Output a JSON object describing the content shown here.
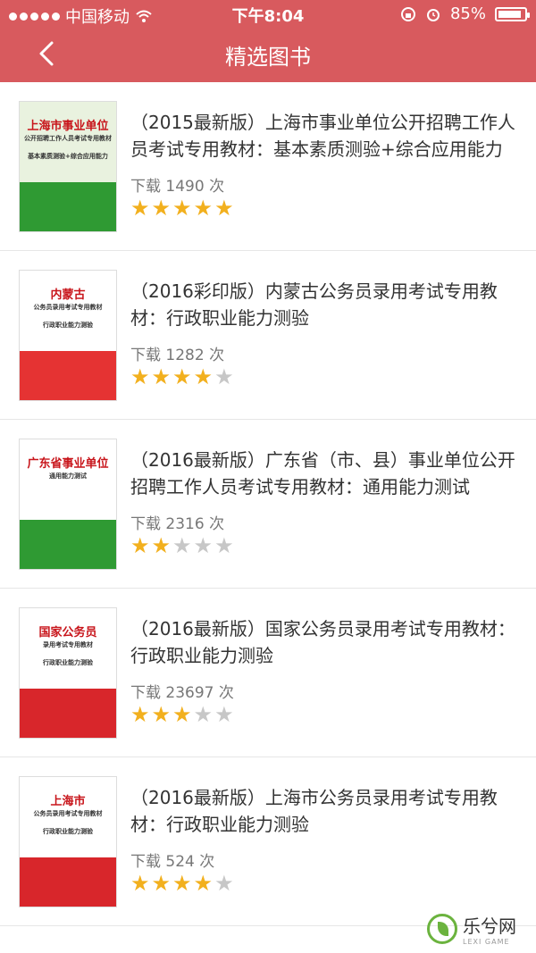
{
  "status": {
    "carrier": "中国移动",
    "time": "下午8:04",
    "battery": "85%"
  },
  "nav": {
    "title": "精选图书"
  },
  "books": [
    {
      "title": "（2015最新版）上海市事业单位公开招聘工作人员考试专用教材：基本素质测验+综合应用能力",
      "downloads": "下载 1490 次",
      "rating": 5,
      "cover": {
        "bg": "#2f9a33",
        "accent": "#e9f2df",
        "lines": [
          "上海市事业单位",
          "公开招聘工作人员考试专用教材",
          "基本素质测验+综合应用能力"
        ]
      }
    },
    {
      "title": "（2016彩印版）内蒙古公务员录用考试专用教材：行政职业能力测验",
      "downloads": "下载 1282 次",
      "rating": 4,
      "cover": {
        "bg": "#e53333",
        "accent": "#ffffff",
        "lines": [
          "内蒙古",
          "公务员录用考试专用教材",
          "行政职业能力测验"
        ]
      }
    },
    {
      "title": "（2016最新版）广东省（市、县）事业单位公开招聘工作人员考试专用教材：通用能力测试",
      "downloads": "下载 2316 次",
      "rating": 2,
      "cover": {
        "bg": "#2f9a33",
        "accent": "#ffffff",
        "lines": [
          "广东省事业单位",
          "通用能力测试"
        ]
      }
    },
    {
      "title": "（2016最新版）国家公务员录用考试专用教材：行政职业能力测验",
      "downloads": "下载 23697 次",
      "rating": 3,
      "cover": {
        "bg": "#d8262b",
        "accent": "#ffffff",
        "lines": [
          "国家公务员",
          "录用考试专用教材",
          "行政职业能力测验"
        ]
      }
    },
    {
      "title": "（2016最新版）上海市公务员录用考试专用教材：行政职业能力测验",
      "downloads": "下载 524 次",
      "rating": 4,
      "cover": {
        "bg": "#d8262b",
        "accent": "#ffffff",
        "lines": [
          "上海市",
          "公务员录用考试专用教材",
          "行政职业能力测验"
        ]
      }
    }
  ],
  "watermark": {
    "text": "乐兮网",
    "sub": "LEXI GAME"
  }
}
